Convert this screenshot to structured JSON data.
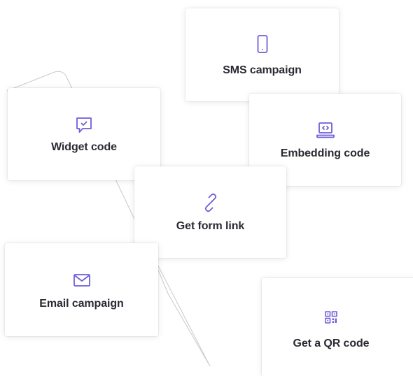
{
  "accent_color": "#6f5fd9",
  "text_color": "#2b2a33",
  "cards": {
    "sms": {
      "label": "SMS campaign",
      "icon": "mobile-phone-icon"
    },
    "widget": {
      "label": "Widget code",
      "icon": "chat-checkmark-icon"
    },
    "embed": {
      "label": "Embedding code",
      "icon": "laptop-code-icon"
    },
    "link": {
      "label": "Get form link",
      "icon": "link-icon"
    },
    "email": {
      "label": "Email campaign",
      "icon": "envelope-icon"
    },
    "qr": {
      "label": "Get a QR code",
      "icon": "qr-code-icon"
    }
  }
}
